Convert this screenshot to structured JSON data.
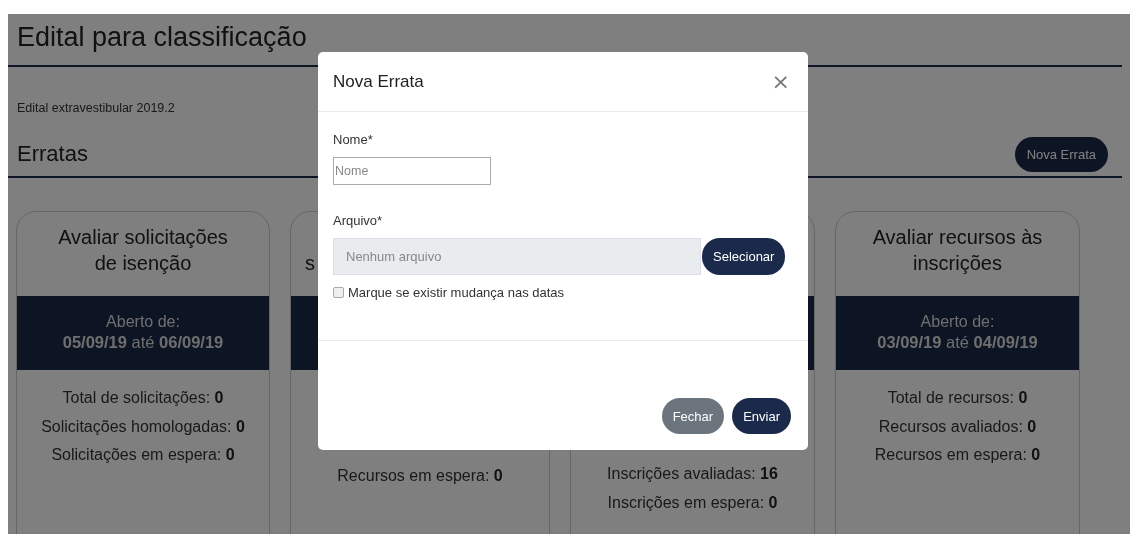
{
  "page": {
    "title": "Edital para classificação",
    "subtitle": "Edital extravestibular 2019.2",
    "section_title": "Erratas",
    "new_button": "Nova Errata"
  },
  "cards": [
    {
      "title": "Avaliar solicitações de isenção",
      "period_label": "Aberto de:",
      "start": "05/09/19",
      "until": "até",
      "end": "06/09/19",
      "stats": [
        {
          "label": "Total de solicitações:",
          "value": "0"
        },
        {
          "label": "Solicitações homologadas:",
          "value": "0"
        },
        {
          "label": "Solicitações em espera:",
          "value": "0"
        }
      ]
    },
    {
      "title": "s",
      "stats": [
        {
          "label": "Recursos em espera:",
          "value": "0"
        }
      ]
    },
    {
      "stats": [
        {
          "label": "Inscrições avaliadas:",
          "value": "16"
        },
        {
          "label": "Inscrições em espera:",
          "value": "0"
        }
      ]
    },
    {
      "title": "Avaliar recursos às inscrições",
      "period_label": "Aberto de:",
      "start": "03/09/19",
      "until": "até",
      "end": "04/09/19",
      "stats": [
        {
          "label": "Total de recursos:",
          "value": "0"
        },
        {
          "label": "Recursos avaliados:",
          "value": "0"
        },
        {
          "label": "Recursos em espera:",
          "value": "0"
        }
      ]
    }
  ],
  "modal": {
    "title": "Nova Errata",
    "close": "×",
    "fields": [
      {
        "kind": "text",
        "label": "Nome*",
        "placeholder": "Nome"
      },
      {
        "kind": "file",
        "label": "Arquivo*",
        "value": "Nenhum arquivo",
        "button": "Selecionar"
      }
    ],
    "checkbox": {
      "label": "Marque se existir mudança nas datas",
      "checked": false
    },
    "buttons": [
      {
        "label": "Fechar",
        "kind": "secondary"
      },
      {
        "label": "Enviar",
        "kind": "primary"
      }
    ]
  }
}
